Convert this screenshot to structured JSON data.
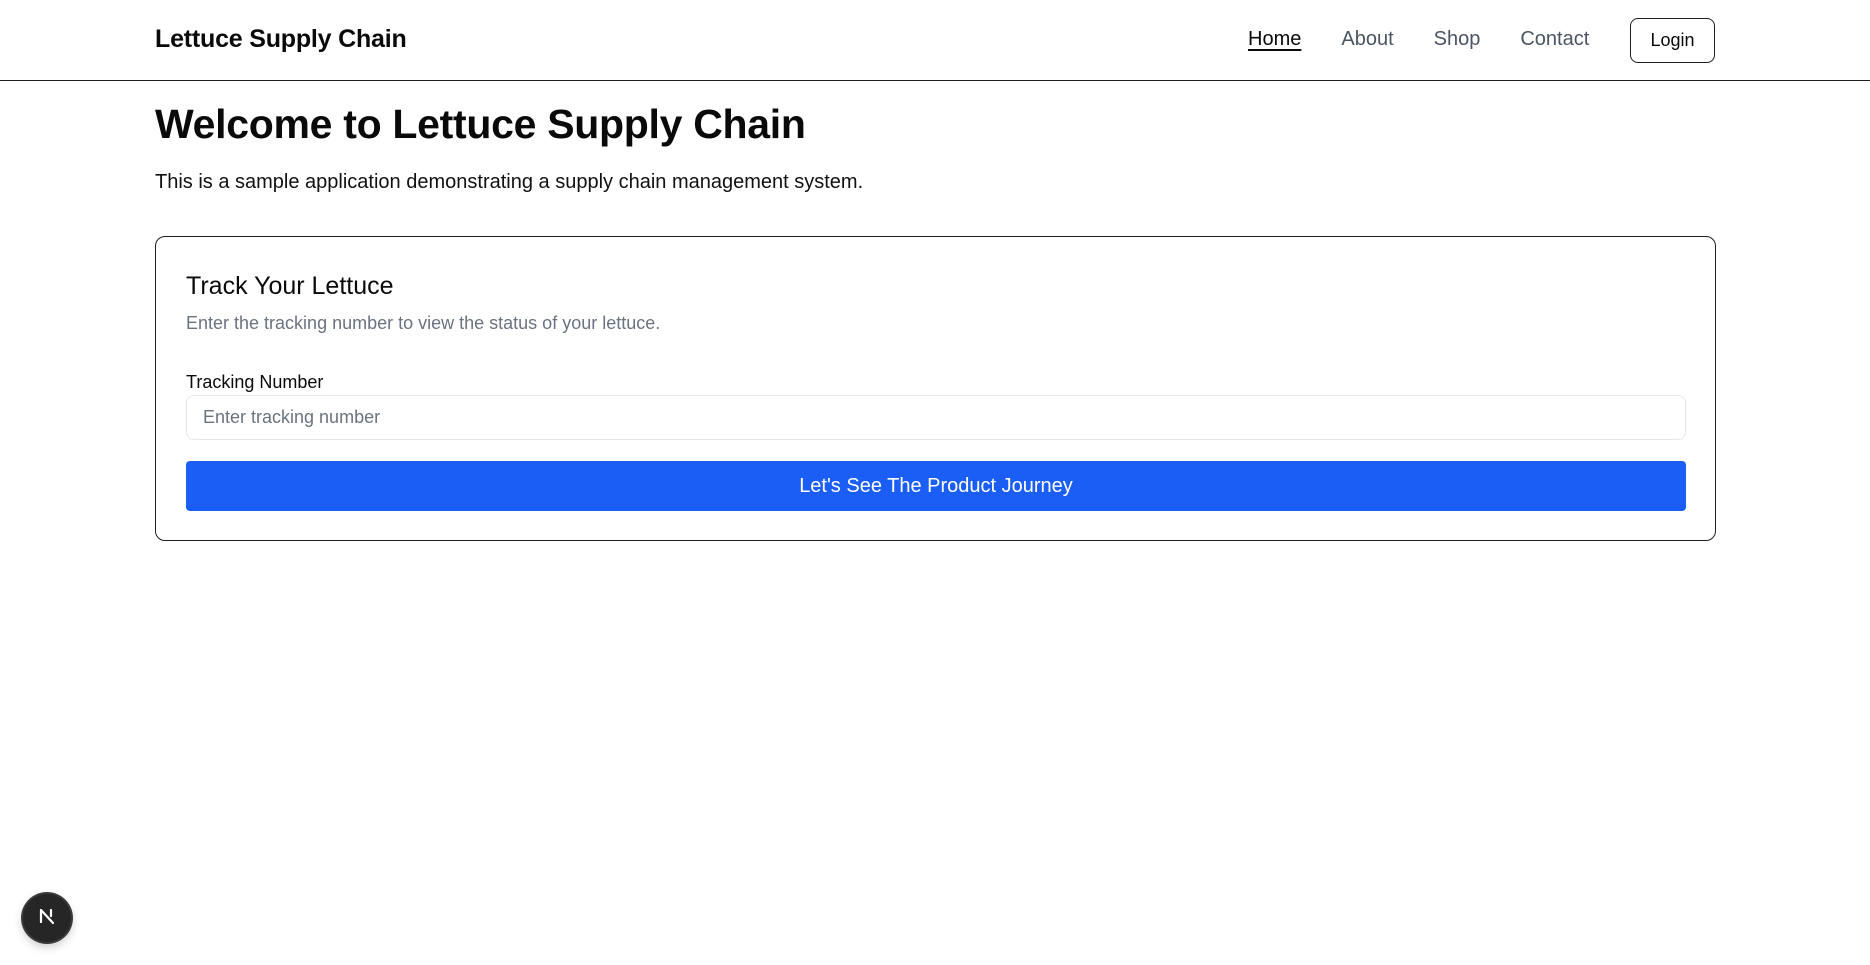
{
  "header": {
    "brand": "Lettuce Supply Chain",
    "nav": [
      {
        "label": "Home",
        "active": true
      },
      {
        "label": "About",
        "active": false
      },
      {
        "label": "Shop",
        "active": false
      },
      {
        "label": "Contact",
        "active": false
      }
    ],
    "login_label": "Login"
  },
  "main": {
    "title": "Welcome to Lettuce Supply Chain",
    "description": "This is a sample application demonstrating a supply chain management system."
  },
  "tracker": {
    "title": "Track Your Lettuce",
    "description": "Enter the tracking number to view the status of your lettuce.",
    "field_label": "Tracking Number",
    "placeholder": "Enter tracking number",
    "value": "",
    "button_label": "Let's See The Product Journey"
  },
  "dev_badge": {
    "icon": "nextjs-logo-icon"
  },
  "colors": {
    "primary": "#1a5ef5",
    "border": "#1f1f1f",
    "muted_text": "#6b7280",
    "nav_text": "#4b5563"
  }
}
